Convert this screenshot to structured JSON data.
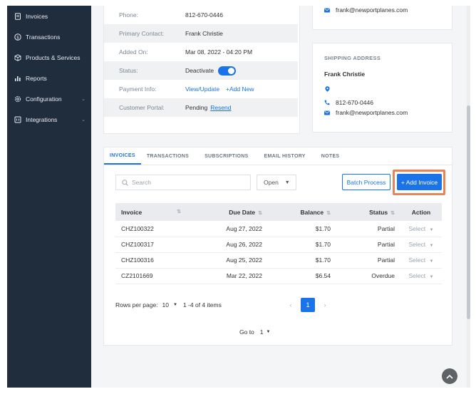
{
  "sidebar": {
    "items": [
      {
        "label": "Invoices",
        "icon": "document-icon",
        "has_submenu": false
      },
      {
        "label": "Transactions",
        "icon": "dollar-circle-icon",
        "has_submenu": false
      },
      {
        "label": "Products & Services",
        "icon": "box-icon",
        "has_submenu": false
      },
      {
        "label": "Reports",
        "icon": "bar-chart-icon",
        "has_submenu": false
      },
      {
        "label": "Configuration",
        "icon": "gear-icon",
        "has_submenu": true
      },
      {
        "label": "Integrations",
        "icon": "plug-icon",
        "has_submenu": true
      }
    ]
  },
  "customer_info": {
    "rows": [
      {
        "key": "Phone:",
        "value": "812-670-0446"
      },
      {
        "key": "Primary Contact:",
        "value": "Frank Christie"
      },
      {
        "key": "Added On:",
        "value": "Mar 08, 2022 - 04:20 PM"
      },
      {
        "key": "Status:",
        "value": "Deactivate"
      },
      {
        "key": "Payment Info:",
        "link1": "View/Update",
        "link2": "+Add New"
      },
      {
        "key": "Customer Portal:",
        "value": "Pending",
        "link": "Resend"
      }
    ]
  },
  "billing": {
    "email": "frank@newportplanes.com"
  },
  "shipping": {
    "title": "SHIPPING ADDRESS",
    "name": "Frank Christie",
    "phone": "812-670-0446",
    "email": "frank@newportplanes.com"
  },
  "tabs": [
    "INVOICES",
    "TRANSACTIONS",
    "SUBSCRIPTIONS",
    "EMAIL HISTORY",
    "NOTES"
  ],
  "toolbar": {
    "search_placeholder": "Search",
    "filter_value": "Open",
    "batch_label": "Batch Process",
    "add_label": "+ Add Invoice"
  },
  "table": {
    "headers": [
      "Invoice",
      "Due Date",
      "Balance",
      "Status",
      "Action"
    ],
    "rows": [
      {
        "invoice": "CHZ100322",
        "due": "Aug 27, 2022",
        "balance": "$1.70",
        "status": "Partial",
        "action": "Select"
      },
      {
        "invoice": "CHZ100317",
        "due": "Aug 26, 2022",
        "balance": "$1.70",
        "status": "Partial",
        "action": "Select"
      },
      {
        "invoice": "CHZ100316",
        "due": "Aug 25, 2022",
        "balance": "$1.70",
        "status": "Partial",
        "action": "Select"
      },
      {
        "invoice": "CZ2101669",
        "due": "Mar 22, 2022",
        "balance": "$6.54",
        "status": "Overdue",
        "action": "Select"
      }
    ]
  },
  "pagination": {
    "rows_label": "Rows per page:",
    "rows_value": "10",
    "range": "1 -4 of 4  items",
    "current_page": "1",
    "goto_label": "Go to",
    "goto_value": "1"
  },
  "colors": {
    "accent": "#1a73e8",
    "sidebar": "#1f2d3d",
    "highlight": "#e8845a"
  }
}
